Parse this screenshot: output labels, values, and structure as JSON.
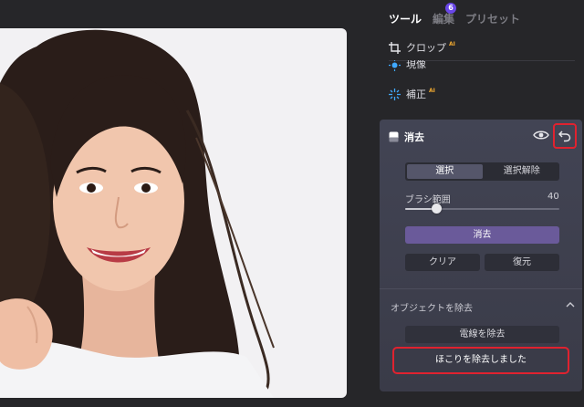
{
  "tabs": [
    {
      "label": "ツール",
      "active": true
    },
    {
      "label": "編集",
      "badge": "6"
    },
    {
      "label": "プリセット"
    }
  ],
  "tools": {
    "crop": {
      "label": "クロップ",
      "ai": "AI"
    },
    "develop": {
      "label": "現像"
    },
    "correct": {
      "label": "補正",
      "ai": "AI"
    }
  },
  "erase": {
    "title": "消去",
    "segment": {
      "select": "選択",
      "deselect": "選択解除"
    },
    "brush": {
      "label": "ブラシ範囲",
      "value": "40",
      "level_fraction": 0.2
    },
    "erase_button": "消去",
    "clear_button": "クリア",
    "restore_button": "復元",
    "object_section": {
      "title": "オブジェクトを除去",
      "wire_button": "電線を除去",
      "dust_button": "ほこりを除去しました"
    }
  },
  "colors": {
    "accent": "#6a47e8",
    "highlight": "#e0222f",
    "ai": "#f0a930"
  }
}
